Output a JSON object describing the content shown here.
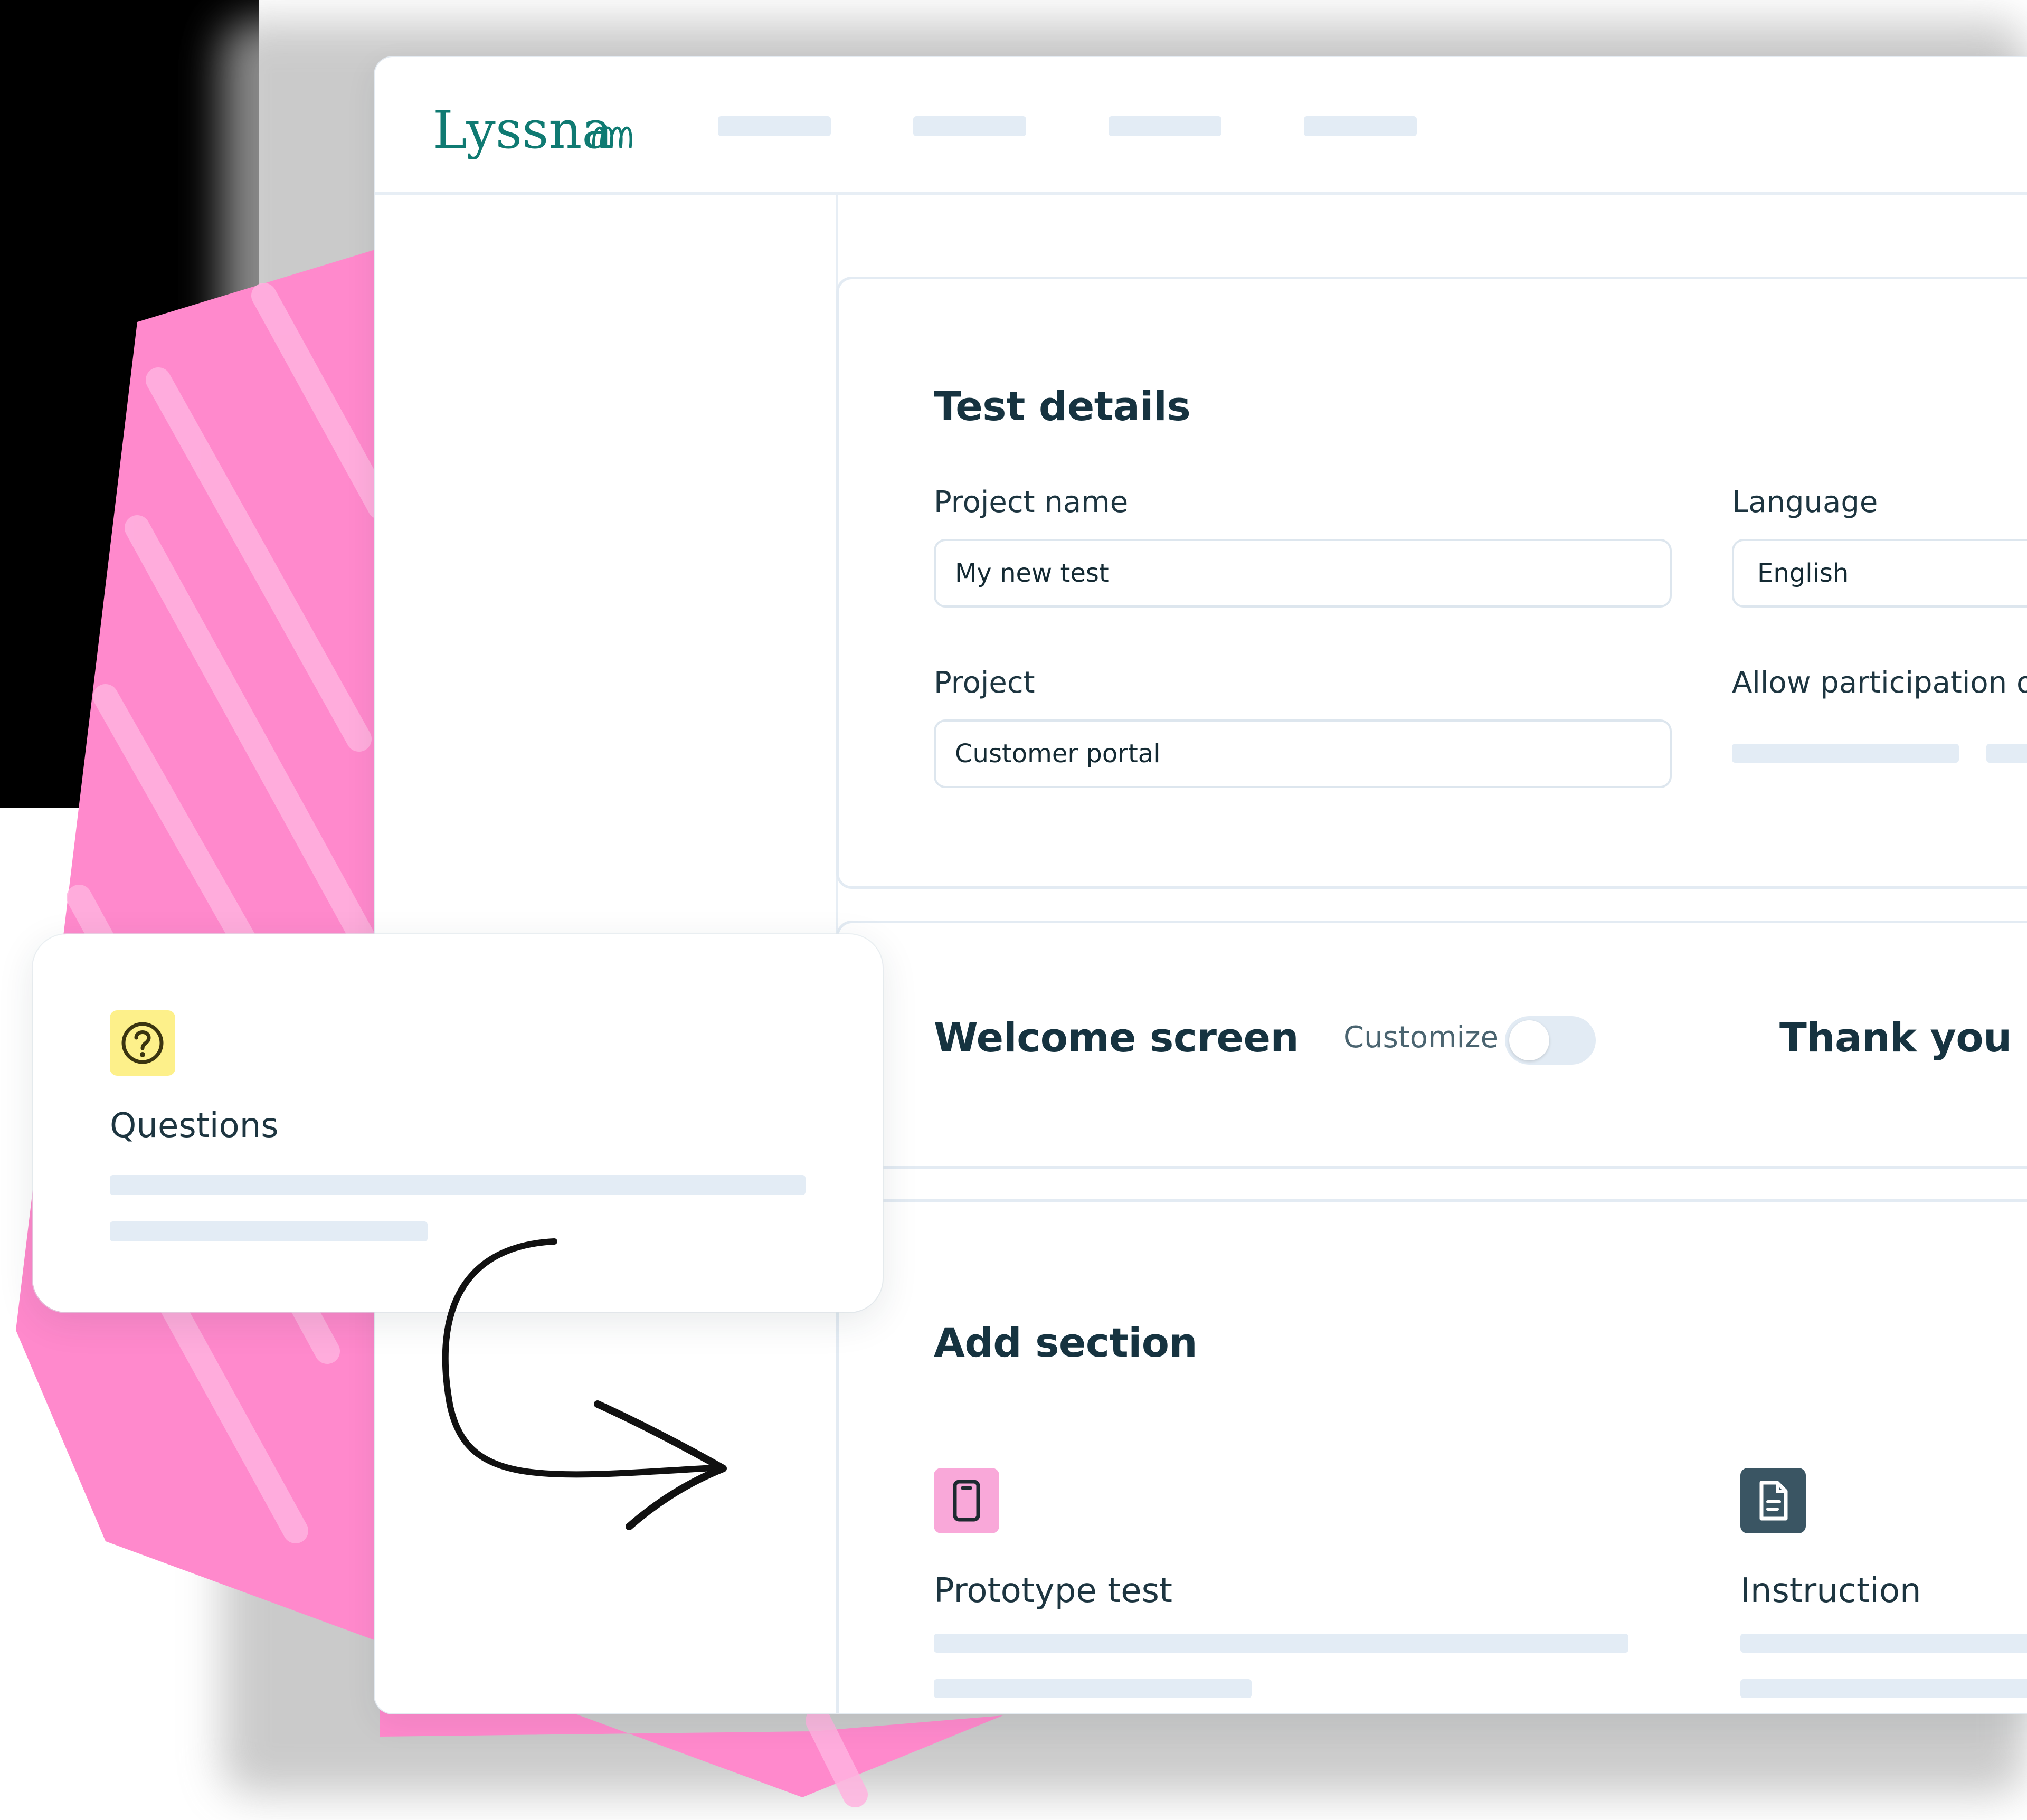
{
  "brand": {
    "logo_text": "Lyssna"
  },
  "nav": {
    "items": [
      "",
      "",
      "",
      ""
    ]
  },
  "test_details": {
    "title": "Test details",
    "project_name_label": "Project name",
    "project_name_value": "My new test",
    "language_label": "Language",
    "language_value": "English",
    "project_label": "Project",
    "project_value": "Customer portal",
    "allow_label": "Allow participation on"
  },
  "screens": {
    "welcome_title": "Welcome screen",
    "customize_label": "Customize",
    "customize_on": false,
    "thank_you_title": "Thank you sc"
  },
  "add_section": {
    "title": "Add section",
    "items": [
      {
        "label": "Prototype test",
        "icon": "phone-icon"
      },
      {
        "label": "Instruction",
        "icon": "document-icon"
      }
    ]
  },
  "questions_card": {
    "label": "Questions",
    "icon": "question-circle-icon"
  },
  "colors": {
    "brand": "#0f7a72",
    "pink": "#ff8fcf",
    "question_icon_bg": "#fdf08a",
    "prototype_icon_bg": "#f9a8d9",
    "instruction_icon_bg": "#3a5563",
    "skeleton": "#e3ecf5"
  }
}
